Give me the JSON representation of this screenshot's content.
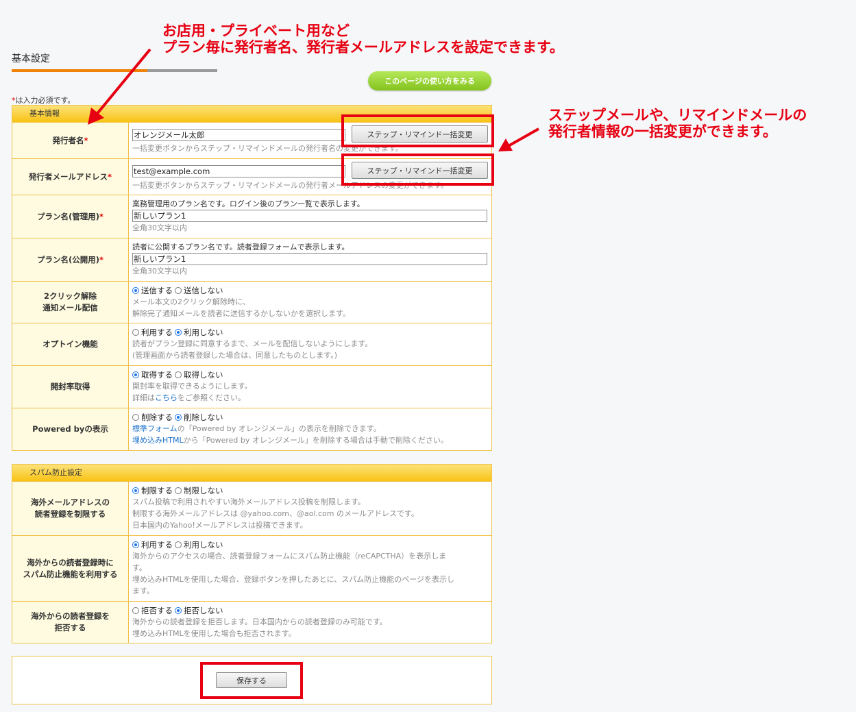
{
  "header": {
    "page_title": "基本設定",
    "help_button": "このページの使い方をみる",
    "required_note": "は入力必須です。",
    "required_mark": "*"
  },
  "basic_section": {
    "title": "基本情報",
    "rows": {
      "sender_name": {
        "label": "発行者名",
        "value": "オレンジメール太郎",
        "button": "ステップ・リマインド一括変更",
        "desc": "一括変更ボタンからステップ・リマインドメールの発行者名の変更ができます。"
      },
      "sender_email": {
        "label": "発行者メールアドレス",
        "value": "test@example.com",
        "button": "ステップ・リマインド一括変更",
        "desc": "一括変更ボタンからステップ・リマインドメールの発行者メールアドレスの変更ができます。"
      },
      "plan_admin": {
        "label": "プラン名(管理用)",
        "intro": "業務管理用のプラン名です。ログイン後のプラン一覧で表示します。",
        "value": "新しいプラン1",
        "desc": "全角30文字以内"
      },
      "plan_public": {
        "label": "プラン名(公開用)",
        "intro": "読者に公開するプラン名です。読者登録フォームで表示します。",
        "value": "新しいプラン1",
        "desc": "全角30文字以内"
      },
      "two_click": {
        "label_line1": "2クリック解除",
        "label_line2": "通知メール配信",
        "option_on": "送信する",
        "option_off": "送信しない",
        "selected": "on",
        "desc1": "メール本文の2クリック解除時に、",
        "desc2": "解除完了通知メールを読者に送信するかしないかを選択します。"
      },
      "optin": {
        "label": "オプトイン機能",
        "option_on": "利用する",
        "option_off": "利用しない",
        "selected": "off",
        "desc1": "読者がプラン登録に同意するまで、メールを配信しないようにします。",
        "desc2": "(管理画面から読者登録した場合は、同意したものとします。)"
      },
      "open_rate": {
        "label": "開封率取得",
        "option_on": "取得する",
        "option_off": "取得しない",
        "selected": "on",
        "desc1": "開封率を取得できるようにします。",
        "desc2_pre": "詳細は",
        "desc2_link": "こちら",
        "desc2_post": "をご参照ください。"
      },
      "powered_by": {
        "label": "Powered byの表示",
        "option_on": "削除する",
        "option_off": "削除しない",
        "selected": "off",
        "desc1_link": "標準フォーム",
        "desc1_post": "の「Powered by オレンジメール」の表示を削除できます。",
        "desc2_link": "埋め込みHTML",
        "desc2_post": "から「Powered by オレンジメール」を削除する場合は手動で削除ください。"
      }
    }
  },
  "spam_section": {
    "title": "スパム防止設定",
    "rows": {
      "foreign_email": {
        "label_line1": "海外メールアドレスの",
        "label_line2": "読者登録を制限する",
        "option_on": "制限する",
        "option_off": "制限しない",
        "selected": "on",
        "desc1": "スパム投稿で利用されやすい海外メールアドレス投稿を制限します。",
        "desc2": "制限する海外メールアドレスは @yahoo.com、@aol.com のメールアドレスです。",
        "desc3": "日本国内のYahoo!メールアドレスは投稿できます。"
      },
      "foreign_spam": {
        "label_line1": "海外からの読者登録時に",
        "label_line2": "スパム防止機能を利用する",
        "option_on": "利用する",
        "option_off": "利用しない",
        "selected": "on",
        "desc1a": "海外からのアクセスの場合、読者登録フォームにスパム防止機能（reCAPCTHA）を表示しま",
        "desc1b": "す。",
        "desc2a": "埋め込みHTMLを使用した場合、登録ボタンを押したあとに、スパム防止機能のページを表示し",
        "desc2b": "ます。"
      },
      "foreign_reject": {
        "label_line1": "海外からの読者登録を",
        "label_line2": "拒否する",
        "option_on": "拒否する",
        "option_off": "拒否しない",
        "selected": "off",
        "desc1": "海外からの読者登録を拒否します。日本国内からの読者登録のみ可能です。",
        "desc2": "埋め込みHTMLを使用した場合も拒否されます。"
      }
    }
  },
  "save": {
    "button": "保存する"
  },
  "annotations": {
    "top_line1": "お店用・プライベート用など",
    "top_line2": "プラン毎に発行者名、発行者メールアドレスを設定できます。",
    "right_line1": "ステップメールや、リマインドメールの",
    "right_line2": "発行者情報の一括変更ができます。",
    "color": "#e60012"
  }
}
